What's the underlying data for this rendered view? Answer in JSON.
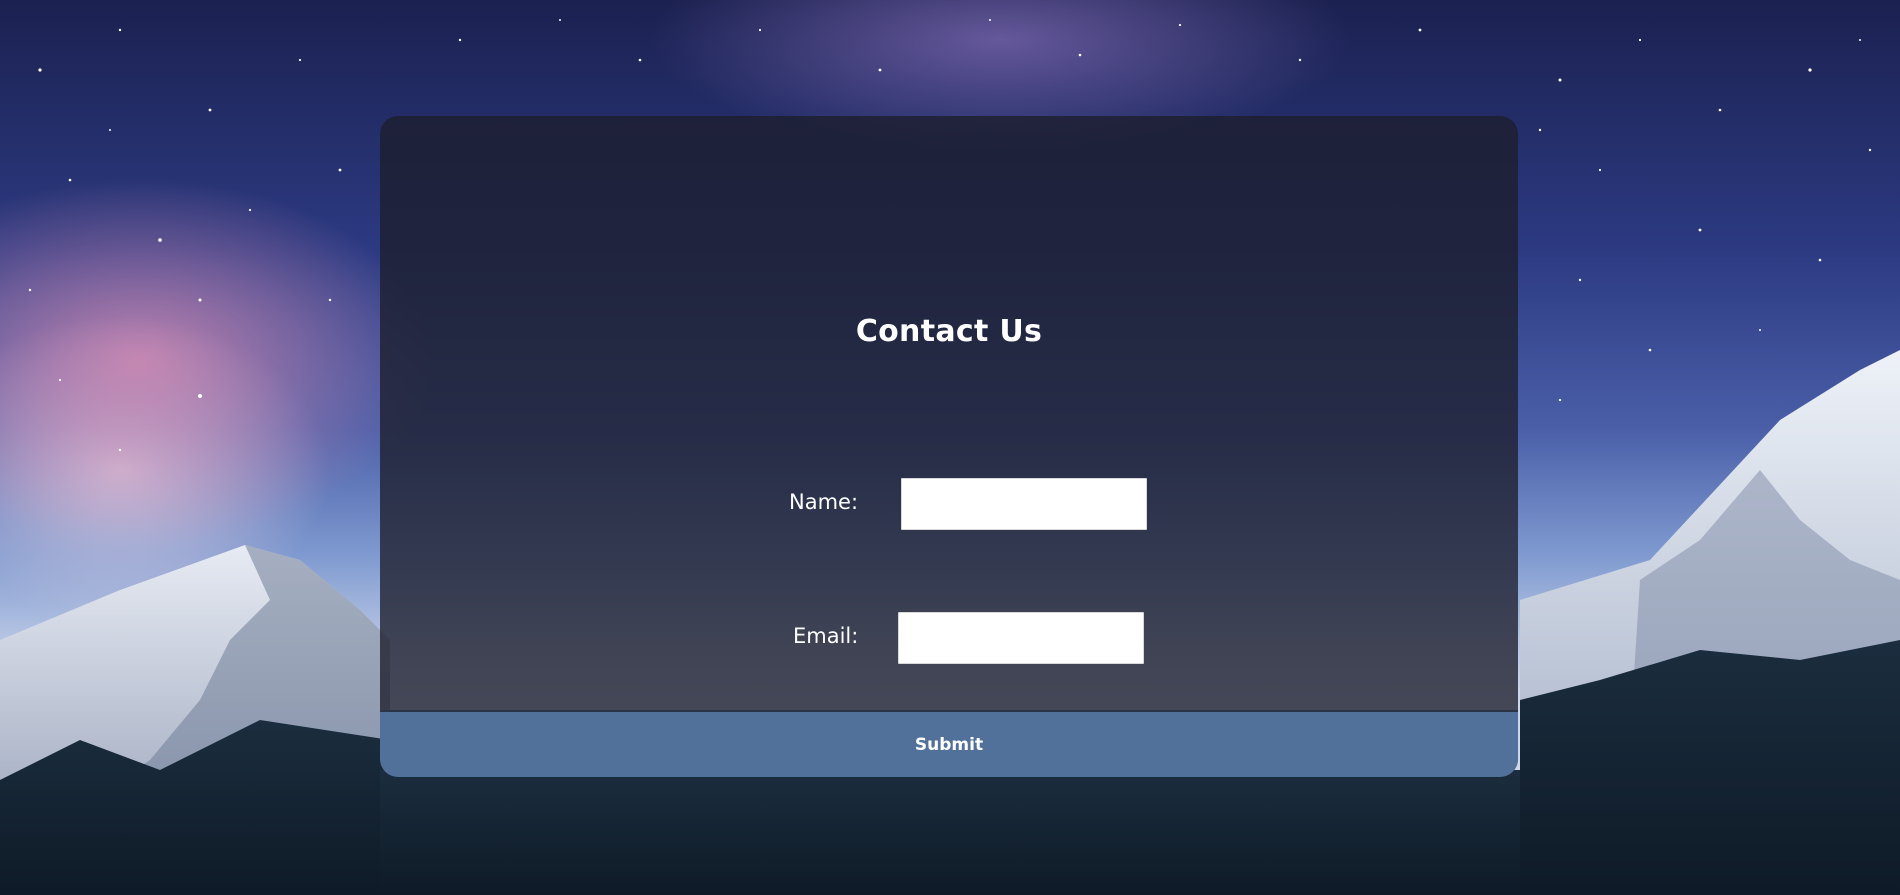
{
  "form": {
    "title": "Contact Us",
    "fields": [
      {
        "label": "Name:",
        "value": "",
        "placeholder": ""
      },
      {
        "label": "Email:",
        "value": "",
        "placeholder": ""
      }
    ],
    "submit_label": "Submit"
  },
  "colors": {
    "card_background": "#1c1e2c",
    "submit_background": "#52719a",
    "text": "#ffffff"
  }
}
